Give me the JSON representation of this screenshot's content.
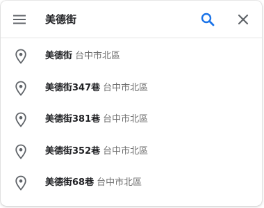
{
  "search": {
    "query": "美德街"
  },
  "results": [
    {
      "name": "美德街",
      "address": "台中市北區"
    },
    {
      "name": "美德街347巷",
      "address": "台中市北區"
    },
    {
      "name": "美德街381巷",
      "address": "台中市北區"
    },
    {
      "name": "美德街352巷",
      "address": "台中市北區"
    },
    {
      "name": "美德街68巷",
      "address": "台中市北區"
    }
  ],
  "icons": {
    "menu": "hamburger-menu-icon",
    "search": "magnifier-icon",
    "close": "close-x-icon",
    "result": "location-pin-icon"
  },
  "colors": {
    "search_icon": "#1a73e8",
    "icon_gray": "#5f6368",
    "text": "#202124",
    "secondary_text": "#6f6f6f"
  }
}
